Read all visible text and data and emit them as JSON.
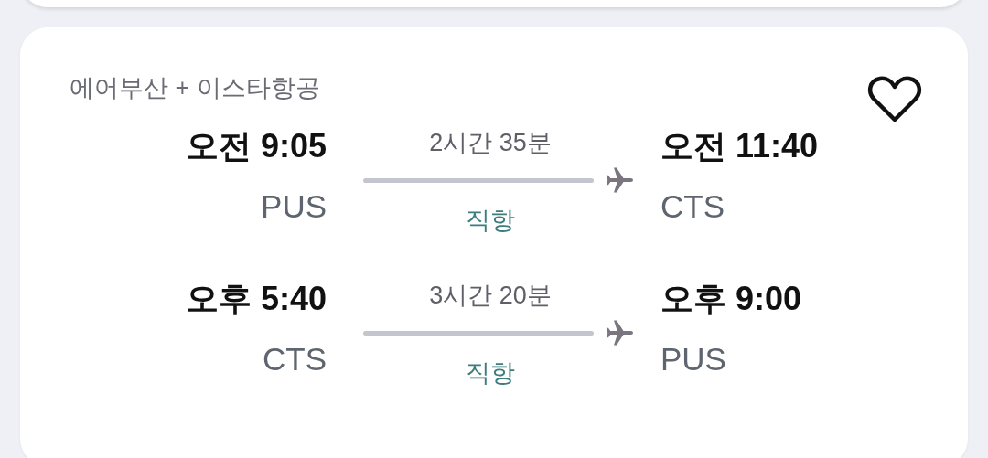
{
  "itinerary": {
    "airline": "에어부산 + 이스타항공",
    "favorite": false,
    "legs": [
      {
        "depart_time": "오전 9:05",
        "depart_code": "PUS",
        "duration": "2시간 35분",
        "stops": "직항",
        "arrive_time": "오전 11:40",
        "arrive_code": "CTS"
      },
      {
        "depart_time": "오후 5:40",
        "depart_code": "CTS",
        "duration": "3시간 20분",
        "stops": "직항",
        "arrive_time": "오후 9:00",
        "arrive_code": "PUS"
      }
    ]
  }
}
